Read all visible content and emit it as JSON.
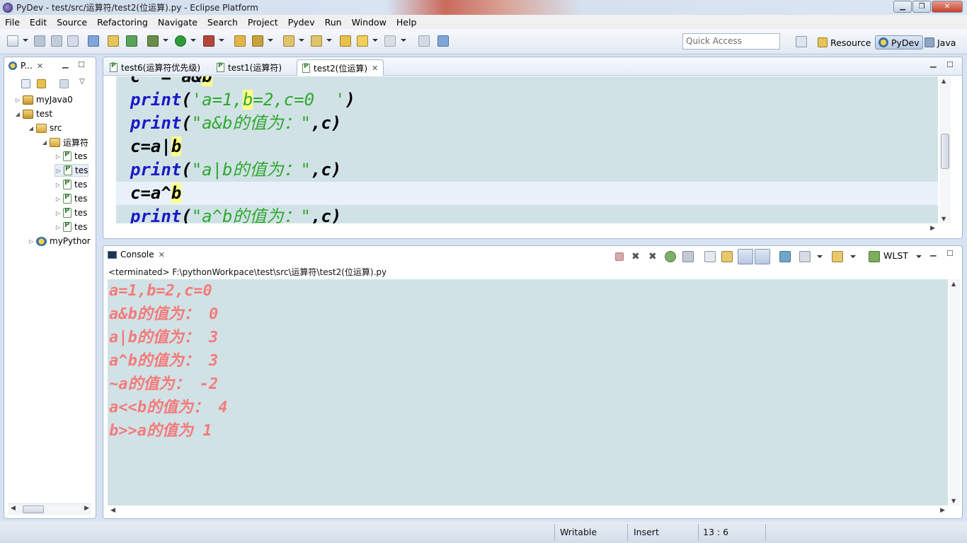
{
  "window": {
    "title": "PyDev - test/src/运算符/test2(位运算).py - Eclipse Platform",
    "minimize": "▁",
    "maximize": "❐",
    "close": "✕"
  },
  "menu": [
    "File",
    "Edit",
    "Source",
    "Refactoring",
    "Navigate",
    "Search",
    "Project",
    "Pydev",
    "Run",
    "Window",
    "Help"
  ],
  "toolbar": {
    "quick_access_placeholder": "Quick Access",
    "perspectives": [
      {
        "label": "Resource",
        "active": false
      },
      {
        "label": "PyDev",
        "active": true
      },
      {
        "label": "Java",
        "active": false
      }
    ]
  },
  "explorer": {
    "tab_label": "P...",
    "tree": [
      {
        "label": "myJava0",
        "indent": 0,
        "twisty": "▷",
        "icon": "proj"
      },
      {
        "label": "test",
        "indent": 0,
        "twisty": "◢",
        "icon": "proj"
      },
      {
        "label": "src",
        "indent": 1,
        "twisty": "◢",
        "icon": "folder"
      },
      {
        "label": "运算符",
        "indent": 2,
        "twisty": "◢",
        "icon": "folder"
      },
      {
        "label": "tes",
        "indent": 3,
        "twisty": "▷",
        "icon": "file"
      },
      {
        "label": "tes",
        "indent": 3,
        "twisty": "▷",
        "icon": "file"
      },
      {
        "label": "tes",
        "indent": 3,
        "twisty": "▷",
        "icon": "file"
      },
      {
        "label": "tes",
        "indent": 3,
        "twisty": "▷",
        "icon": "file"
      },
      {
        "label": "tes",
        "indent": 3,
        "twisty": "▷",
        "icon": "file"
      },
      {
        "label": "tes",
        "indent": 3,
        "twisty": "▷",
        "icon": "file"
      },
      {
        "label": "myPythor",
        "indent": 1,
        "twisty": "▷",
        "icon": "py"
      }
    ]
  },
  "editor": {
    "tabs": [
      {
        "label": "test6(运算符优先级)",
        "active": false
      },
      {
        "label": "test1(运算符)",
        "active": false
      },
      {
        "label": "test2(位运算)",
        "active": true
      }
    ],
    "lines": [
      {
        "text_a": "c ",
        "text_b": " = a&",
        "text_c": "b"
      },
      {
        "kw": "print",
        "rest1": "(",
        "str": "'a=1,",
        "hl": "b",
        "str2": "=2,c=0  '",
        "rest2": ")"
      },
      {
        "kw": "print",
        "rest1": "(",
        "str": "\"a&b的值为：\"",
        "rest2": ",c)"
      },
      {
        "pre": "c=a|",
        "hl": "b"
      },
      {
        "kw": "print",
        "rest1": "(",
        "str": "\"a|b的值为：\"",
        "rest2": ",c)"
      },
      {
        "pre": "c=a^",
        "hl": "b"
      },
      {
        "kw": "print",
        "rest1": "(",
        "str": "\"a^b的值为：\"",
        "rest2": ",c)"
      }
    ]
  },
  "console": {
    "tab_label": "Console",
    "wlst_label": "WLST",
    "description": "<terminated> F:\\pythonWorkpace\\test\\src\\运算符\\test2(位运算).py",
    "output": [
      "a=1,b=2,c=0",
      "a&b的值为： 0",
      "a|b的值为： 3",
      "a^b的值为： 3",
      "~a的值为： -2",
      "a<<b的值为： 4",
      "b>>a的值为 1"
    ]
  },
  "status": {
    "writable": "Writable",
    "insert": "Insert",
    "position": "13 : 6"
  },
  "colors": {
    "keyword": "#1a1ac8",
    "string": "#2fa82f",
    "console_output": "#f47b7b",
    "editor_bg": "#d1e2e6"
  }
}
